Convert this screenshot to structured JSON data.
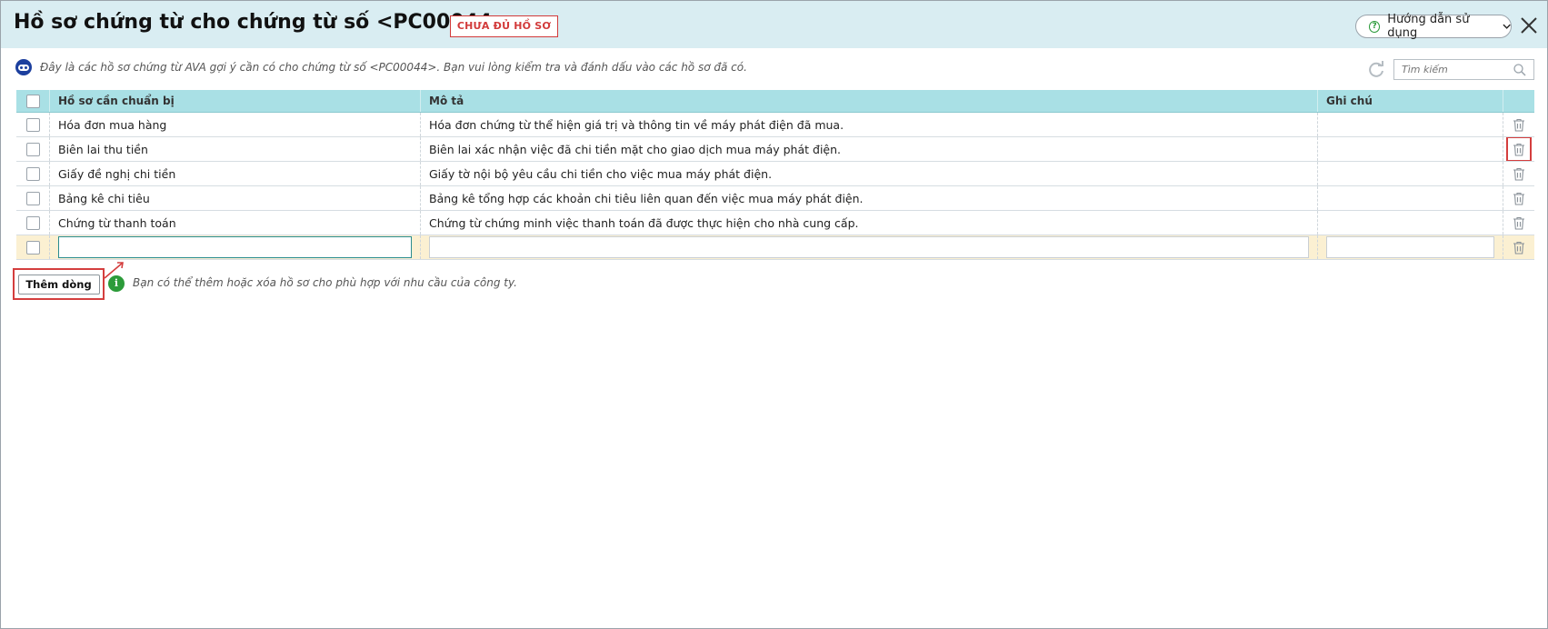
{
  "header": {
    "title": "Hồ sơ chứng từ cho chứng từ số <PC00044>",
    "status_badge": "CHƯA ĐỦ HỒ SƠ",
    "help_label": "Hướng dẫn sử dụng",
    "help_icon": "question-circle-icon",
    "close_icon": "close-icon"
  },
  "info": {
    "text": "Đây là các hồ sơ chứng từ AVA gợi ý cần có cho chứng từ số <PC00044>. Bạn vui lòng kiểm tra và đánh dấu vào các hồ sơ đã có.",
    "search_placeholder": "Tìm kiếm"
  },
  "table": {
    "columns": [
      "Hồ sơ cần chuẩn bị",
      "Mô tả",
      "Ghi chú"
    ],
    "rows": [
      {
        "name": "Hóa đơn mua hàng",
        "description": "Hóa đơn chứng từ thể hiện giá trị và thông tin về máy phát điện đã mua.",
        "note": ""
      },
      {
        "name": "Biên lai thu tiền",
        "description": "Biên lai xác nhận việc đã chi tiền mặt cho giao dịch mua máy phát điện.",
        "note": ""
      },
      {
        "name": "Giấy đề nghị chi tiền",
        "description": "Giấy tờ nội bộ yêu cầu chi tiền cho việc mua máy phát điện.",
        "note": ""
      },
      {
        "name": "Bảng kê chi tiêu",
        "description": "Bảng kê tổng hợp các khoản chi tiêu liên quan đến việc mua máy phát điện.",
        "note": ""
      },
      {
        "name": "Chứng từ thanh toán",
        "description": "Chứng từ chứng minh việc thanh toán đã được thực hiện cho nhà cung cấp.",
        "note": ""
      }
    ],
    "new_row": {
      "name": "",
      "description": "",
      "note": ""
    }
  },
  "footer": {
    "add_row_label": "Thêm dòng",
    "hint": "Bạn có thể thêm hoặc xóa hồ sơ cho phù hợp với nhu cầu của công ty."
  },
  "colors": {
    "header_bg": "#d9edf2",
    "table_header_bg": "#a9e0e5",
    "badge_red": "#d23a3a",
    "highlight_red": "#d43e3e",
    "ava_blue": "#1c3f9e",
    "info_green": "#2c9b3a",
    "edit_row_bg": "#fbf0d2"
  }
}
